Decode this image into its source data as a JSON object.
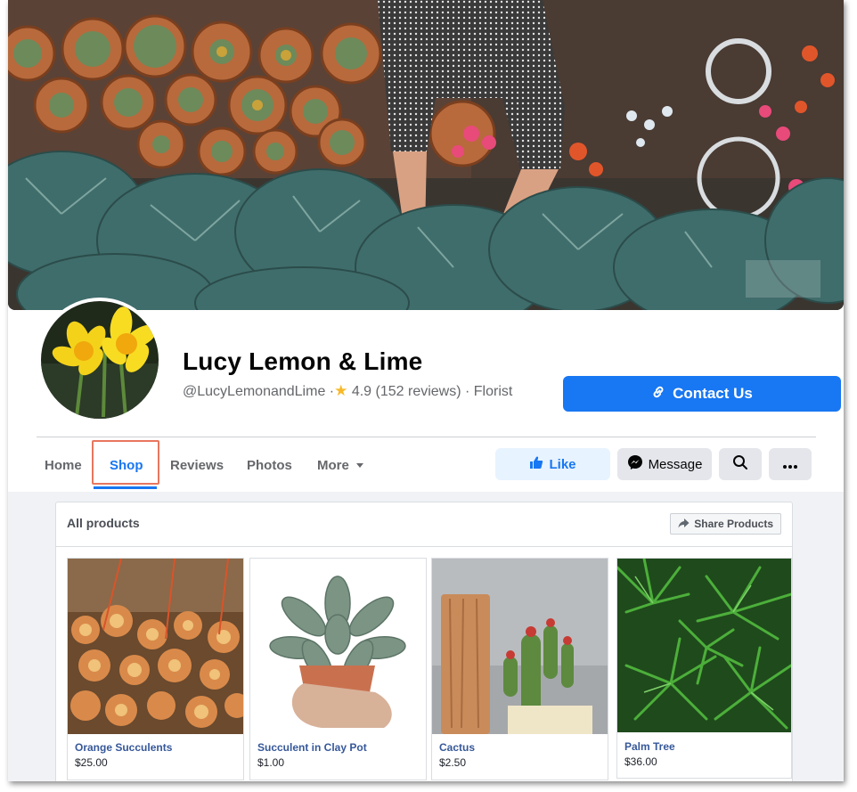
{
  "page": {
    "name": "Lucy Lemon & Lime",
    "handle": "@LucyLemonandLime",
    "separator": "·",
    "rating": "4.9 (152 reviews)",
    "category_sep": "·",
    "category": "Florist"
  },
  "contact_button": "Contact Us",
  "tabs": [
    {
      "label": "Home"
    },
    {
      "label": "Shop"
    },
    {
      "label": "Reviews"
    },
    {
      "label": "Photos"
    },
    {
      "label": "More"
    }
  ],
  "active_tab": "Shop",
  "actions": {
    "like": "Like",
    "message": "Message"
  },
  "shop": {
    "title": "All products",
    "share_label": "Share Products",
    "products": [
      {
        "name": "Orange Succulents",
        "price": "$25.00"
      },
      {
        "name": "Succulent in Clay Pot",
        "price": "$1.00"
      },
      {
        "name": "Cactus",
        "price": "$2.50"
      },
      {
        "name": "Palm Tree",
        "price": "$36.00"
      }
    ]
  },
  "colors": {
    "accent": "#1877f2",
    "highlight_box": "#e8765e",
    "product_link": "#365899"
  }
}
